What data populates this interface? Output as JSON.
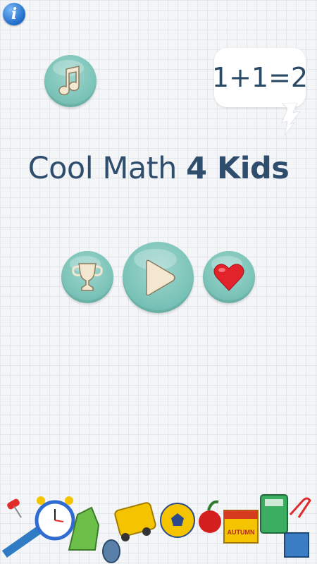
{
  "info_button": {
    "label": "i"
  },
  "bubble": {
    "equation": "1+1=2"
  },
  "title": {
    "normal": "Cool Math ",
    "bold": "4 Kids"
  },
  "footer": {
    "calendar_label": "AUTUMN"
  },
  "icons": {
    "info": "info-icon",
    "music": "music-note-icon",
    "trophy": "trophy-icon",
    "play": "play-icon",
    "heart": "heart-icon"
  },
  "colors": {
    "button_teal": "#79c2b7",
    "title": "#2f4e6e",
    "heart_red": "#e2232b",
    "icon_cream": "#f3e7cf"
  }
}
